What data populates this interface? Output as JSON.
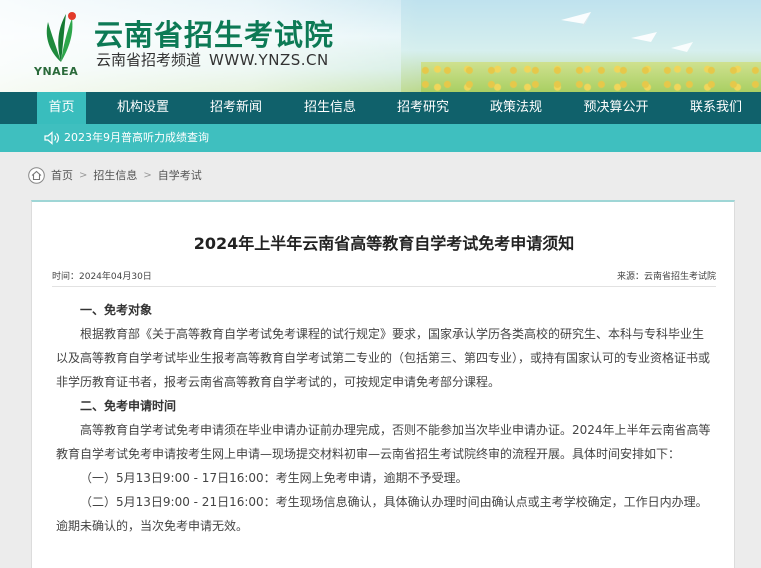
{
  "header": {
    "title": "云南省招生考试院",
    "subtitle": "云南省招考频道",
    "url": "WWW.YNZS.CN",
    "logo_text": "YNAEA"
  },
  "nav": {
    "items": [
      {
        "label": "首页",
        "active": true
      },
      {
        "label": "机构设置"
      },
      {
        "label": "招考新闻"
      },
      {
        "label": "招生信息"
      },
      {
        "label": "招考研究"
      },
      {
        "label": "政策法规"
      },
      {
        "label": "预决算公开"
      },
      {
        "label": "联系我们"
      }
    ]
  },
  "ticker": {
    "text": "2023年9月普高听力成绩查询"
  },
  "breadcrumb": {
    "items": [
      "首页",
      "招生信息",
      "自学考试"
    ],
    "separator": ">"
  },
  "article": {
    "title": "2024年上半年云南省高等教育自学考试免考申请须知",
    "time": "时间：2024年04月30日",
    "source": "来源：云南省招生考试院",
    "paragraphs": [
      {
        "type": "heading",
        "text": "一、免考对象"
      },
      {
        "type": "text",
        "text": "根据教育部《关于高等教育自学考试免考课程的试行规定》要求，国家承认学历各类高校的研究生、本科与专科毕业生以及高等教育自学考试毕业生报考高等教育自学考试第二专业的（包括第三、第四专业），或持有国家认可的专业资格证书或非学历教育证书者，报考云南省高等教育自学考试的，可按规定申请免考部分课程。"
      },
      {
        "type": "heading",
        "text": "二、免考申请时间"
      },
      {
        "type": "text",
        "text": "高等教育自学考试免考申请须在毕业申请办证前办理完成，否则不能参加当次毕业申请办证。2024年上半年云南省高等教育自学考试免考申请按考生网上申请—现场提交材料初审—云南省招生考试院终审的流程开展。具体时间安排如下："
      },
      {
        "type": "text",
        "text": "（一）5月13日9:00 - 17日16:00：考生网上免考申请，逾期不予受理。"
      },
      {
        "type": "text",
        "text": "（二）5月13日9:00 - 21日16:00：考生现场信息确认，具体确认办理时间由确认点或主考学校确定，工作日内办理。逾期未确认的，当次免考申请无效。"
      }
    ]
  },
  "colors": {
    "nav_bg": "#10616b",
    "nav_active": "#39bdbd",
    "ticker_bg": "#3fbfbf",
    "title_green": "#0d7a55"
  },
  "icons": {
    "logo": "ynaea-leaf-logo",
    "ticker": "speaker-icon",
    "breadcrumb_home": "home-icon"
  }
}
